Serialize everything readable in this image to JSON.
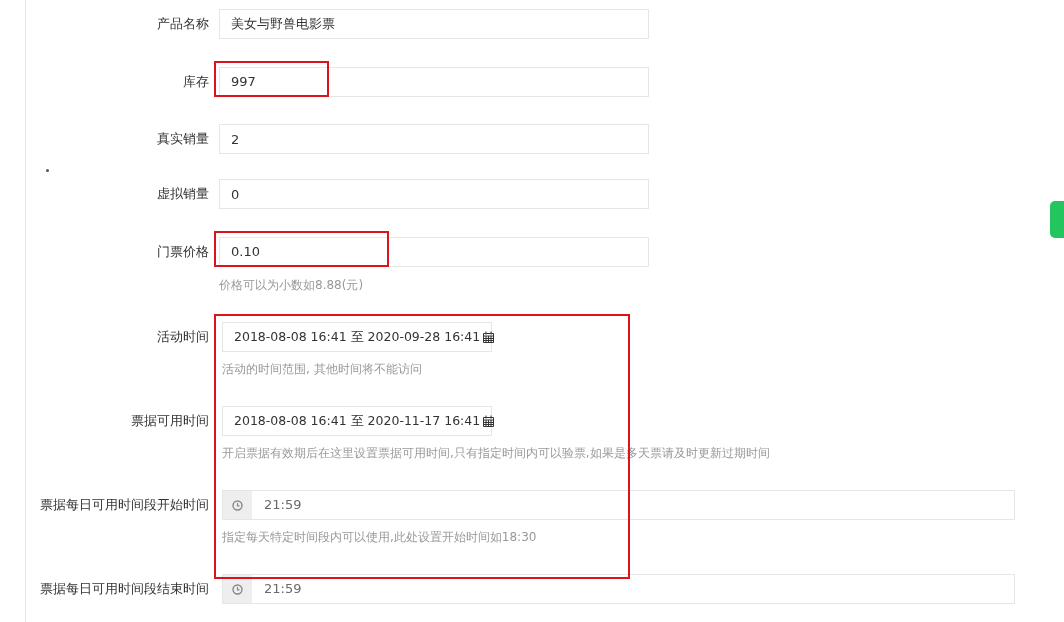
{
  "fields": [
    {
      "label": "产品名称",
      "value": "美女与野兽电影票",
      "highlighted": false
    },
    {
      "label": "库存",
      "value": "997",
      "highlighted": true
    },
    {
      "label": "真实销量",
      "value": "2",
      "highlighted": false
    },
    {
      "label": "虚拟销量",
      "value": "0",
      "highlighted": false
    },
    {
      "label": "门票价格",
      "value": "0.10",
      "highlighted": true,
      "hint": "价格可以为小数如8.88(元)"
    }
  ],
  "time_section": {
    "highlighted": true,
    "rows": [
      {
        "kind": "date-range",
        "label": "活动时间",
        "value": "2018-08-08 16:41 至 2020-09-28 16:41",
        "hint": "活动的时间范围, 其他时间将不能访问"
      },
      {
        "kind": "date-range",
        "label": "票据可用时间",
        "value": "2018-08-08 16:41 至 2020-11-17 16:41",
        "hint": "开启票据有效期后在这里设置票据可用时间,只有指定时间内可以验票,如果是多天票请及时更新过期时间"
      },
      {
        "kind": "time",
        "label": "票据每日可用时间段开始时间",
        "value": "21:59",
        "hint": "指定每天特定时间段内可以使用,此处设置开始时间如18:30"
      },
      {
        "kind": "time",
        "label": "票据每日可用时间段结束时间",
        "value": "21:59"
      }
    ]
  }
}
